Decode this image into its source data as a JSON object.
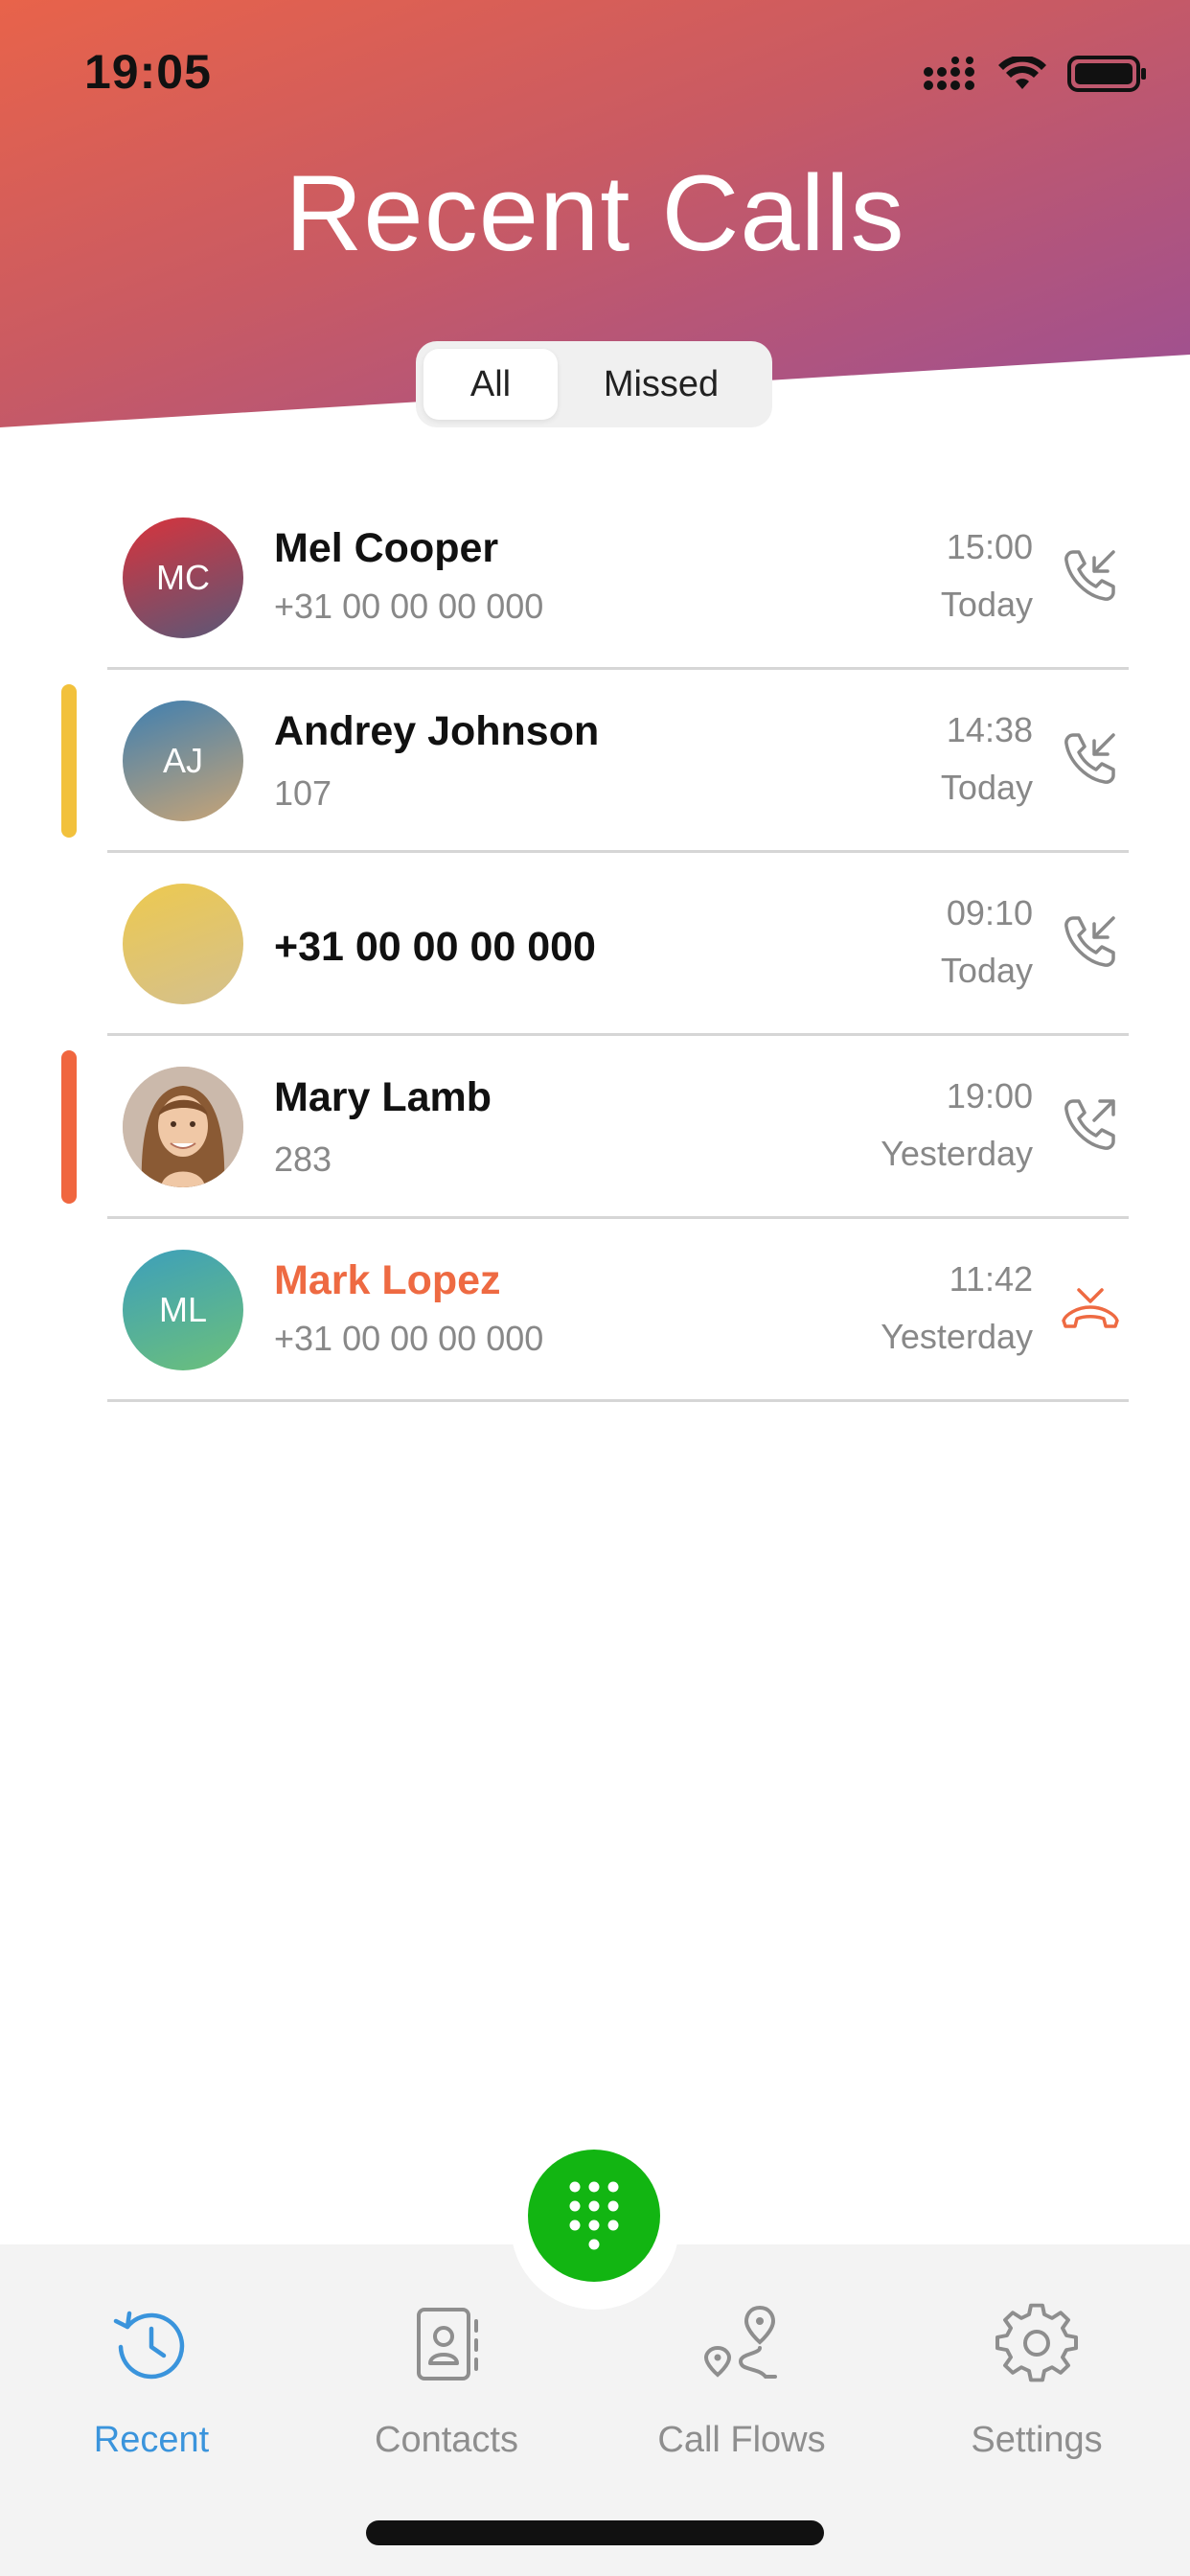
{
  "status_bar": {
    "time": "19:05",
    "icons": [
      "signal-icon",
      "wifi-icon",
      "battery-icon"
    ]
  },
  "header": {
    "title": "Recent Calls"
  },
  "filter": {
    "options": [
      "All",
      "Missed"
    ],
    "selected": "All"
  },
  "calls": [
    {
      "initials": "MC",
      "name": "Mel Cooper",
      "number": "+31 00 00 00 000",
      "time": "15:00",
      "day": "Today",
      "direction": "incoming",
      "avatar_colors": [
        "#d8333c",
        "#5a5878"
      ]
    },
    {
      "initials": "AJ",
      "name": "Andrey Johnson",
      "number": "107",
      "time": "14:38",
      "day": "Today",
      "direction": "incoming",
      "marker_color": "#f2c13c",
      "avatar_colors": [
        "#3f7fb0",
        "#c8a476"
      ]
    },
    {
      "initials": "",
      "name": "+31 00 00 00 000",
      "number": "",
      "time": "09:10",
      "day": "Today",
      "direction": "incoming",
      "avatar_colors": [
        "#edc94f",
        "#d4c08e"
      ]
    },
    {
      "initials": "",
      "name": "Mary Lamb",
      "number": "283",
      "time": "19:00",
      "day": "Yesterday",
      "direction": "outgoing",
      "marker_color": "#f0663f",
      "avatar_photo": true
    },
    {
      "initials": "ML",
      "name": "Mark Lopez",
      "number": "+31 00 00 00 000",
      "time": "11:42",
      "day": "Yesterday",
      "direction": "missed",
      "avatar_colors": [
        "#3d9fbb",
        "#6cc07a"
      ]
    }
  ],
  "tabbar": {
    "tabs": [
      {
        "label": "Recent",
        "icon": "history-icon",
        "active": true
      },
      {
        "label": "Contacts",
        "icon": "contacts-icon",
        "active": false
      },
      {
        "label": "Call Flows",
        "icon": "route-icon",
        "active": false
      },
      {
        "label": "Settings",
        "icon": "gear-icon",
        "active": false
      }
    ]
  },
  "dialpad_button": {
    "icon": "dialpad-icon"
  },
  "colors": {
    "accent": "#3a94dc",
    "dialpad": "#12b512",
    "missed": "#ee6a42"
  }
}
